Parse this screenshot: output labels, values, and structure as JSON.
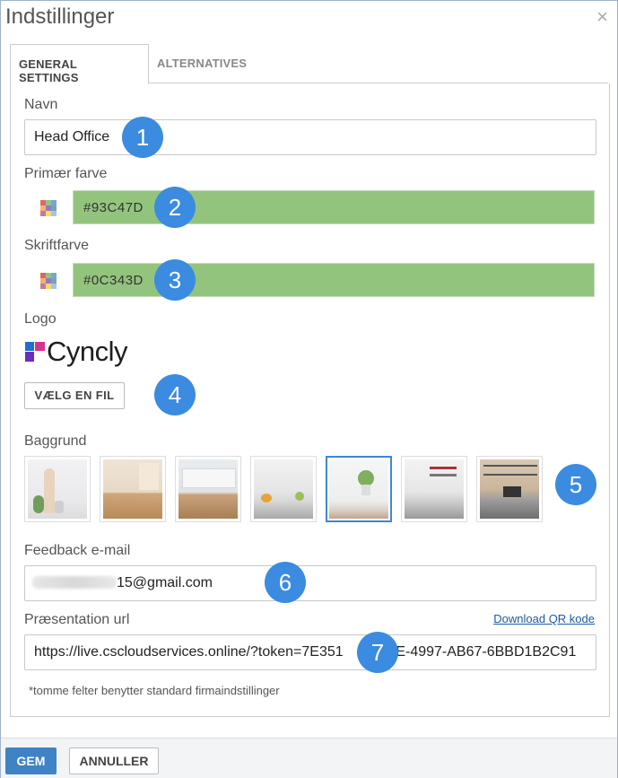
{
  "dialog": {
    "title": "Indstillinger",
    "close_glyph": "×"
  },
  "tabs": [
    {
      "label": "GENERAL SETTINGS",
      "active": true
    },
    {
      "label": "ALTERNATIVES",
      "active": false
    }
  ],
  "form": {
    "name": {
      "label": "Navn",
      "value": "Head Office"
    },
    "primary_color": {
      "label": "Primær farve",
      "value": "#93C47D"
    },
    "font_color": {
      "label": "Skriftfarve",
      "value": "#0C343D"
    },
    "logo": {
      "label": "Logo",
      "brand_text": "Cyncly",
      "choose_file_label": "VÆLG EN FIL"
    },
    "background": {
      "label": "Baggrund",
      "thumbnail_count": 7,
      "selected_index": 4
    },
    "feedback_email": {
      "label": "Feedback e-mail",
      "visible_suffix": "15@gmail.com"
    },
    "presentation_url": {
      "label": "Præsentation url",
      "value": "https://live.cscloudservices.online/?token=7E351",
      "value_tail": "F9E-4997-AB67-6BBD1B2C91",
      "download_link": "Download QR kode"
    },
    "hint": "*tomme felter benytter standard firmaindstillinger"
  },
  "footer": {
    "save_label": "GEM",
    "cancel_label": "ANNULLER"
  },
  "callouts": [
    "1",
    "2",
    "3",
    "4",
    "5",
    "6",
    "7"
  ],
  "colors": {
    "accent": "#3b8be0",
    "primary_swatch": "#93C47D",
    "save_button": "#3f83c4"
  }
}
